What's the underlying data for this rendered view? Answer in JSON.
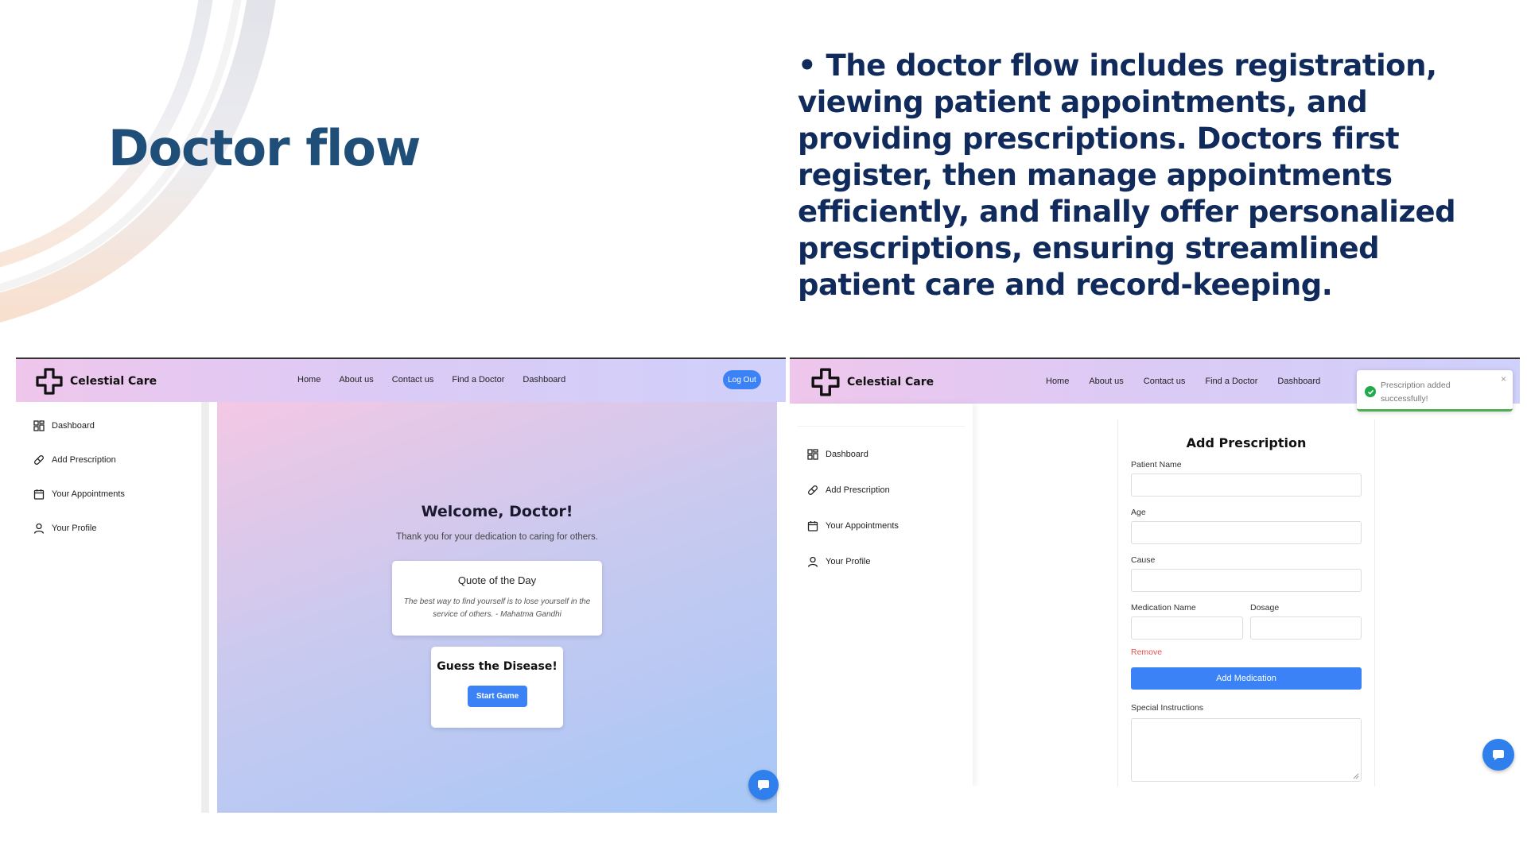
{
  "slide": {
    "title": "Doctor flow",
    "bullet": "• The doctor flow includes registration, viewing patient appointments, and providing prescriptions. Doctors first register, then manage appointments efficiently, and finally offer personalized prescriptions, ensuring streamlined patient care and record-keeping."
  },
  "brand": {
    "name": "Celestial Care",
    "accent": "#3b82f6"
  },
  "nav": {
    "links": [
      "Home",
      "About us",
      "Contact us",
      "Find a Doctor",
      "Dashboard"
    ],
    "logout": "Log Out"
  },
  "sidebar": {
    "items": [
      {
        "label": "Dashboard",
        "icon": "grid-icon"
      },
      {
        "label": "Add Prescription",
        "icon": "pill-icon"
      },
      {
        "label": "Your Appointments",
        "icon": "calendar-icon"
      },
      {
        "label": "Your Profile",
        "icon": "user-icon"
      }
    ]
  },
  "dashboard": {
    "welcome": "Welcome, Doctor!",
    "thanks": "Thank you for your dedication to caring for others.",
    "quote_title": "Quote of the Day",
    "quote_text": "The best way to find yourself is to lose yourself in the service of others. - Mahatma Gandhi",
    "game_title": "Guess the Disease!",
    "start_button": "Start Game"
  },
  "form": {
    "title": "Add Prescription",
    "patient_name_label": "Patient Name",
    "age_label": "Age",
    "cause_label": "Cause",
    "medication_name_label": "Medication Name",
    "dosage_label": "Dosage",
    "remove_label": "Remove",
    "add_medication": "Add Medication",
    "special_instructions_label": "Special Instructions"
  },
  "toast": {
    "message": "Prescription added successfully!",
    "close": "×"
  }
}
